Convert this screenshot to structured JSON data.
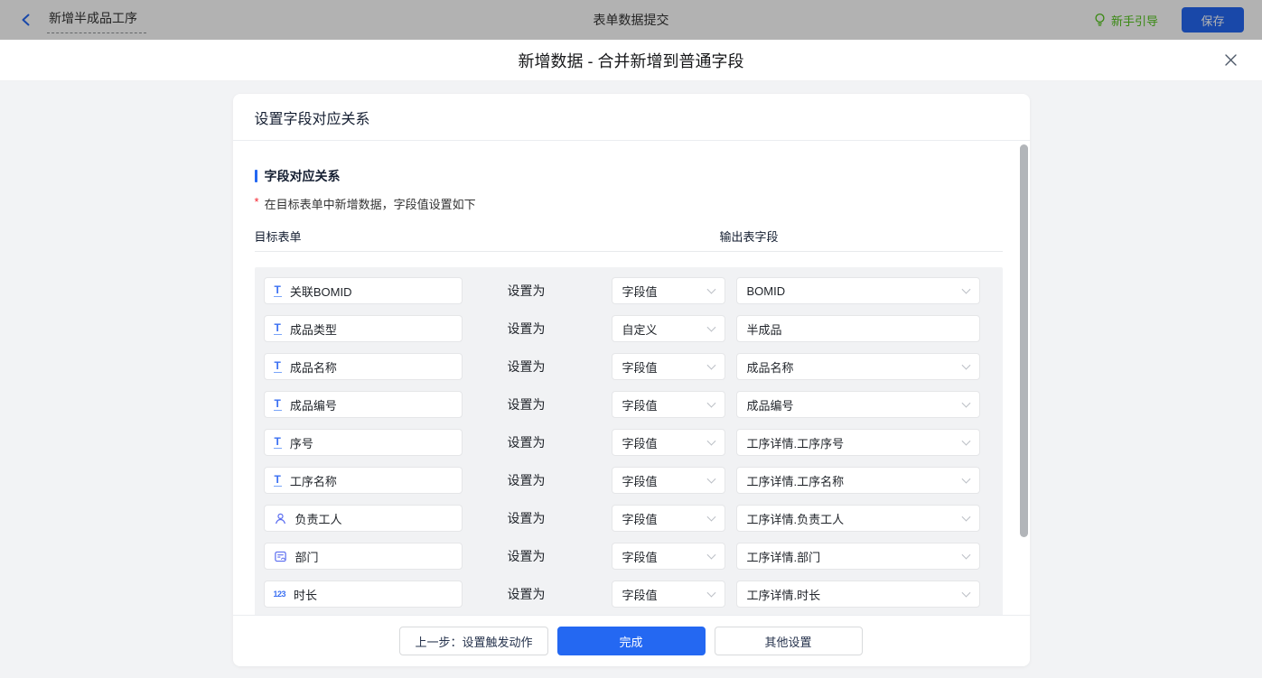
{
  "topbar": {
    "flow_title": "新增半成品工序",
    "page_title": "表单数据提交",
    "guide_label": "新手引导",
    "save_label": "保存"
  },
  "modal": {
    "title": "新增数据 - 合并新增到普通字段"
  },
  "panel": {
    "header": "设置字段对应关系",
    "section_title": "字段对应关系",
    "hint_star": "*",
    "hint_text": "在目标表单中新增数据，字段值设置如下",
    "col_left": "目标表单",
    "col_right": "输出表字段"
  },
  "rows": [
    {
      "icon": "text-field-icon",
      "field": "关联BOMID",
      "set_as": "设置为",
      "mode": "字段值",
      "value": "BOMID",
      "value_kind": "select"
    },
    {
      "icon": "text-field-icon",
      "field": "成品类型",
      "set_as": "设置为",
      "mode": "自定义",
      "value": "半成品",
      "value_kind": "input"
    },
    {
      "icon": "text-field-icon",
      "field": "成品名称",
      "set_as": "设置为",
      "mode": "字段值",
      "value": "成品名称",
      "value_kind": "select"
    },
    {
      "icon": "text-field-icon",
      "field": "成品编号",
      "set_as": "设置为",
      "mode": "字段值",
      "value": "成品编号",
      "value_kind": "select"
    },
    {
      "icon": "text-field-icon",
      "field": "序号",
      "set_as": "设置为",
      "mode": "字段值",
      "value": "工序详情.工序序号",
      "value_kind": "select"
    },
    {
      "icon": "text-field-icon",
      "field": "工序名称",
      "set_as": "设置为",
      "mode": "字段值",
      "value": "工序详情.工序名称",
      "value_kind": "select"
    },
    {
      "icon": "member-field-icon",
      "field": "负责工人",
      "set_as": "设置为",
      "mode": "字段值",
      "value": "工序详情.负责工人",
      "value_kind": "select"
    },
    {
      "icon": "dept-field-icon",
      "field": "部门",
      "set_as": "设置为",
      "mode": "字段值",
      "value": "工序详情.部门",
      "value_kind": "select"
    },
    {
      "icon": "number-field-icon",
      "field": "时长",
      "set_as": "设置为",
      "mode": "字段值",
      "value": "工序详情.时长",
      "value_kind": "select"
    }
  ],
  "number_icon_text": "123",
  "text_icon_text": "T",
  "footer": {
    "prev_label": "上一步：设置触发动作",
    "done_label": "完成",
    "other_label": "其他设置"
  },
  "colors": {
    "primary_blue": "#2468f2",
    "guide_green": "#52c41a",
    "required_red": "#f5222d",
    "field_icon_blue": "#3a6ff2",
    "person_icon_indigo": "#5b6df0"
  }
}
